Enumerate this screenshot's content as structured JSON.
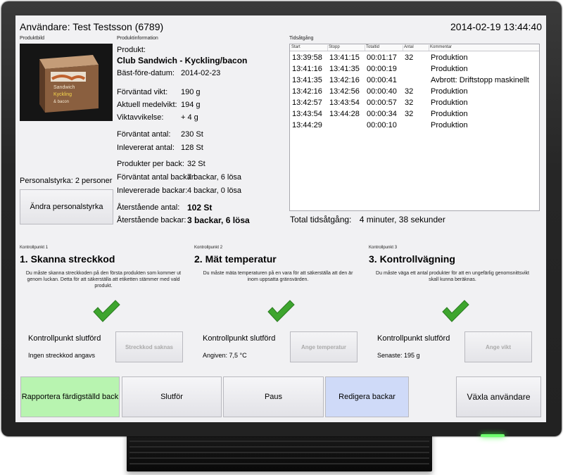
{
  "header": {
    "user_title": "Användare: Test Testsson (6789)",
    "datetime": "2014-02-19 13:44:40"
  },
  "product_image": {
    "caption": "Produktbild",
    "box_text": [
      "Sandwich",
      "Kyckling",
      "& bacon"
    ],
    "box_color": "#8a5f3f"
  },
  "staff": {
    "label": "Personalstyrka: 2 personer",
    "change_button": "Ändra personalstyrka"
  },
  "product_info": {
    "caption": "Produktinformation",
    "product_label": "Produkt:",
    "product_name": "Club Sandwich - Kyckling/bacon",
    "rows": [
      {
        "label": "Bäst-före-datum:",
        "value": "2014-02-23"
      },
      {
        "label": "Förväntad vikt:",
        "value": "190 g"
      },
      {
        "label": "Aktuell medelvikt:",
        "value": "194 g"
      },
      {
        "label": "Viktavvikelse:",
        "value": "+ 4 g"
      },
      {
        "label": "Förväntat antal:",
        "value": "230 St"
      },
      {
        "label": "Inlevererat antal:",
        "value": "128 St"
      },
      {
        "label": "Produkter per back:",
        "value": "32 St"
      },
      {
        "label": "Förväntat antal backar:",
        "value": "7 backar, 6 lösa"
      },
      {
        "label": "Inlevererade backar:",
        "value": "4 backar, 0 lösa"
      },
      {
        "label": "Återstående antal:",
        "value": "102 St"
      },
      {
        "label": "Återstående backar:",
        "value": "3 backar, 6 lösa"
      }
    ]
  },
  "time_log": {
    "caption": "Tidsåtgång",
    "columns": [
      "Start",
      "Stopp",
      "Totaltid",
      "Antal",
      "Kommentar"
    ],
    "rows": [
      [
        "13:39:58",
        "13:41:15",
        "00:01:17",
        "32",
        "Produktion"
      ],
      [
        "13:41:16",
        "13:41:35",
        "00:00:19",
        "",
        "Produktion"
      ],
      [
        "13:41:35",
        "13:42:16",
        "00:00:41",
        "",
        "Avbrott: Driftstopp maskinellt"
      ],
      [
        "13:42:16",
        "13:42:56",
        "00:00:40",
        "32",
        "Produktion"
      ],
      [
        "13:42:57",
        "13:43:54",
        "00:00:57",
        "32",
        "Produktion"
      ],
      [
        "13:43:54",
        "13:44:28",
        "00:00:34",
        "32",
        "Produktion"
      ],
      [
        "13:44:29",
        "",
        "00:00:10",
        "",
        "Produktion"
      ]
    ],
    "total_label": "Total tidsåtgång:",
    "total_value": "4 minuter, 38 sekunder"
  },
  "checkpoints": [
    {
      "caption": "Kontrollpunkt 1",
      "title": "1. Skanna streckkod",
      "description": "Du måste skanna streckkoden på den första produkten som kommer ut genom luckan. Detta för att säkerställa att etiketten stämmer med vald produkt.",
      "done_label": "Kontrollpunkt slutförd",
      "status": "Ingen streckkod angavs",
      "button": "Streckkod saknas"
    },
    {
      "caption": "Kontrollpunkt 2",
      "title": "2. Mät temperatur",
      "description": "Du måste mäta temperaturen på en vara för att säkerställa att den är inom uppsatta gränsvärden.",
      "done_label": "Kontrollpunkt slutförd",
      "status": "Angiven: 7,5 °C",
      "button": "Ange temperatur"
    },
    {
      "caption": "Kontrollpunkt 3",
      "title": "3. Kontrollvägning",
      "description": "Du måste väga ett antal produkter för att en ungefärlig genomsnittsvikt skall kunna beräknas.",
      "done_label": "Kontrollpunkt slutförd",
      "status": "Senaste: 195 g",
      "button": "Ange vikt"
    }
  ],
  "bottom_bar": {
    "report": "Rapportera färdigställd back",
    "finish": "Slutför",
    "pause": "Paus",
    "edit": "Redigera backar",
    "switch_user": "Växla användare"
  },
  "colors": {
    "check_green": "#3ea52e",
    "report_bg": "#b8f4b0",
    "edit_bg": "#cfdaf8",
    "led": "#6dff6d"
  }
}
